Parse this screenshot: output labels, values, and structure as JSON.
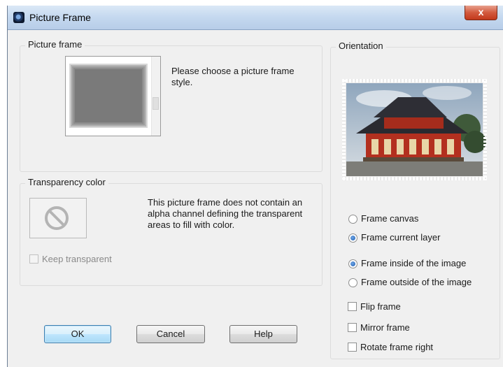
{
  "window": {
    "title": "Picture Frame",
    "close_label": "x"
  },
  "picture_frame": {
    "legend": "Picture frame",
    "instruction": "Please choose a picture frame style."
  },
  "transparency": {
    "legend": "Transparency color",
    "message": "This picture frame does not contain an alpha channel defining the transparent areas to fill with color.",
    "keep_transparent_label": "Keep transparent",
    "keep_transparent_checked": false,
    "keep_transparent_disabled": true
  },
  "orientation": {
    "legend": "Orientation",
    "radios": [
      {
        "label": "Frame canvas",
        "checked": false
      },
      {
        "label": "Frame current layer",
        "checked": true
      },
      {
        "label": "Frame inside of the image",
        "checked": true
      },
      {
        "label": "Frame outside of the image",
        "checked": false
      }
    ],
    "checkboxes": [
      {
        "label": "Flip frame",
        "checked": false
      },
      {
        "label": "Mirror frame",
        "checked": false
      },
      {
        "label": "Rotate frame right",
        "checked": false
      }
    ]
  },
  "buttons": {
    "ok": "OK",
    "cancel": "Cancel",
    "help": "Help"
  },
  "icons": {
    "app": "picture-frame-app-icon",
    "no_color": "no-symbol-icon",
    "preview_image": "temple-photo"
  },
  "colors": {
    "accent": "#3c7fb1",
    "close": "#c2391c",
    "temple_roof": "#2a2a30",
    "temple_wall": "#b3301f"
  }
}
